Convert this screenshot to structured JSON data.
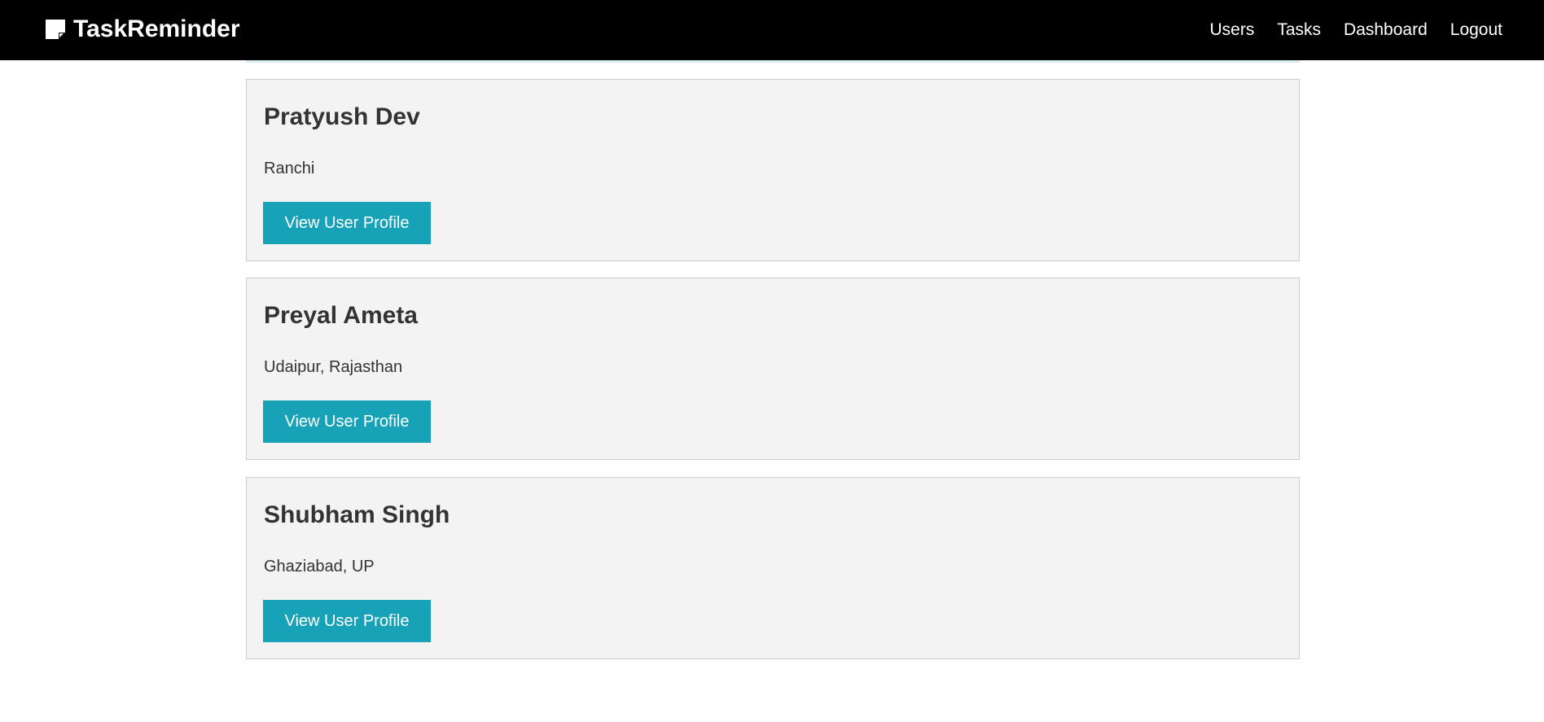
{
  "navbar": {
    "brand": "TaskReminder",
    "brand_icon": "sticky-note-icon",
    "links": [
      "Users",
      "Tasks",
      "Dashboard",
      "Logout"
    ]
  },
  "users": [
    {
      "name": "Pratyush Dev",
      "location": "Ranchi",
      "button_label": "View User Profile"
    },
    {
      "name": "Preyal Ameta",
      "location": "Udaipur, Rajasthan",
      "button_label": "View User Profile"
    },
    {
      "name": "Shubham Singh",
      "location": "Ghaziabad, UP",
      "button_label": "View User Profile"
    }
  ],
  "colors": {
    "navbar_bg": "#000000",
    "button_bg": "#17a2b8",
    "card_bg": "#f3f3f3"
  }
}
